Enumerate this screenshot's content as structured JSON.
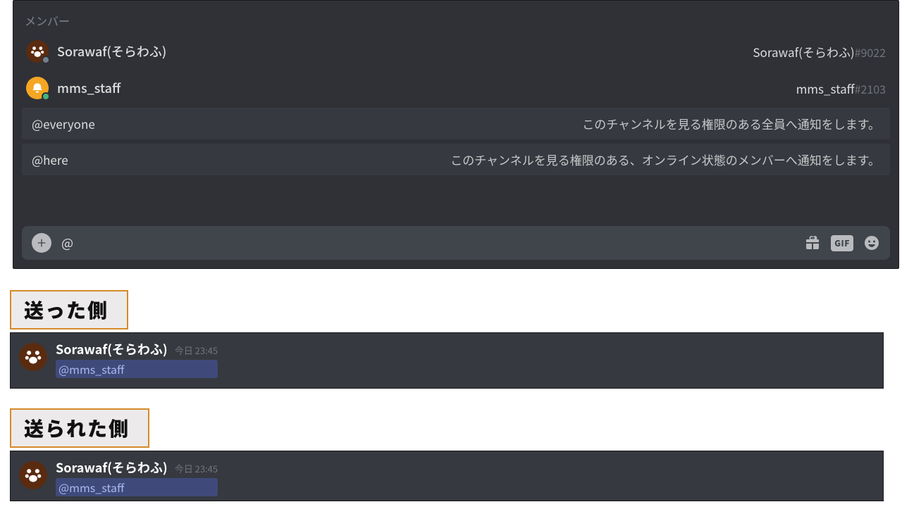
{
  "picker": {
    "section_label": "メンバー",
    "members": [
      {
        "name": "Sorawaf(そらわふ)",
        "tag_name": "Sorawaf(そらわふ)",
        "discriminator": "#9022",
        "avatar": "paw",
        "status_color": "#747f8d"
      },
      {
        "name": "mms_staff",
        "tag_name": "mms_staff",
        "discriminator": "#2103",
        "avatar": "orange",
        "status_color": "#43b581"
      }
    ],
    "roles": [
      {
        "label": "@everyone",
        "desc": "このチャンネルを見る権限のある全員へ通知をします。"
      },
      {
        "label": "@here",
        "desc": "このチャンネルを見る権限のある、オンライン状態のメンバーへ通知をします。"
      }
    ],
    "compose_value": "@",
    "gif_label": "GIF"
  },
  "annotations": {
    "sent_side": "送った側",
    "received_side": "送られた側"
  },
  "messages": [
    {
      "author": "Sorawaf(そらわふ)",
      "time": "今日 23:45",
      "mention": "@mms_staff"
    },
    {
      "author": "Sorawaf(そらわふ)",
      "time": "今日 23:45",
      "mention": "@mms_staff"
    }
  ],
  "colors": {
    "mention_bg": "#3f4a7a",
    "mention_fg": "#aab6f0",
    "annotation_border": "#d78a28"
  }
}
